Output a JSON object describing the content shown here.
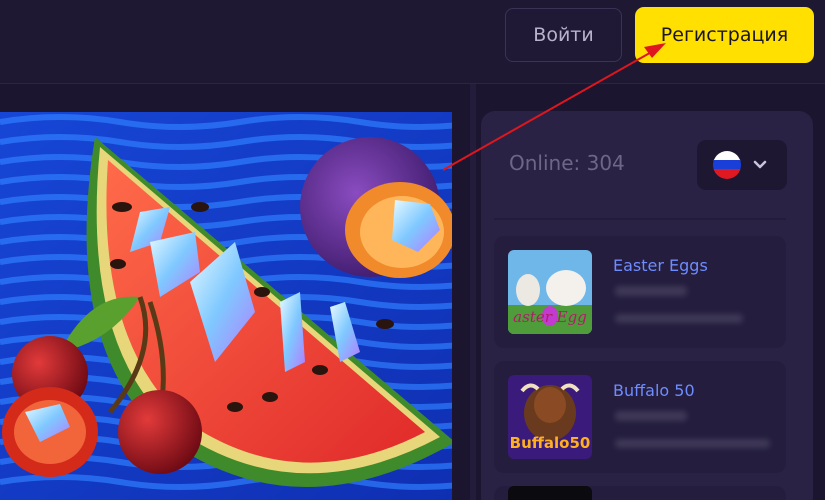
{
  "header": {
    "login_label": "Войти",
    "register_label": "Регистрация"
  },
  "sidebar": {
    "online_label": "Online: 304",
    "language": "ru-flag-icon",
    "games": [
      {
        "name": "Easter Eggs",
        "thumb_text": "Easter Eggs"
      },
      {
        "name": "Buffalo 50",
        "thumb_text": "Buffalo 50"
      }
    ]
  },
  "colors": {
    "accent": "#ffe000",
    "link": "#6e8cff",
    "background": "#1b1530",
    "panel": "#2a2244",
    "annotation_arrow": "#e0161e"
  }
}
